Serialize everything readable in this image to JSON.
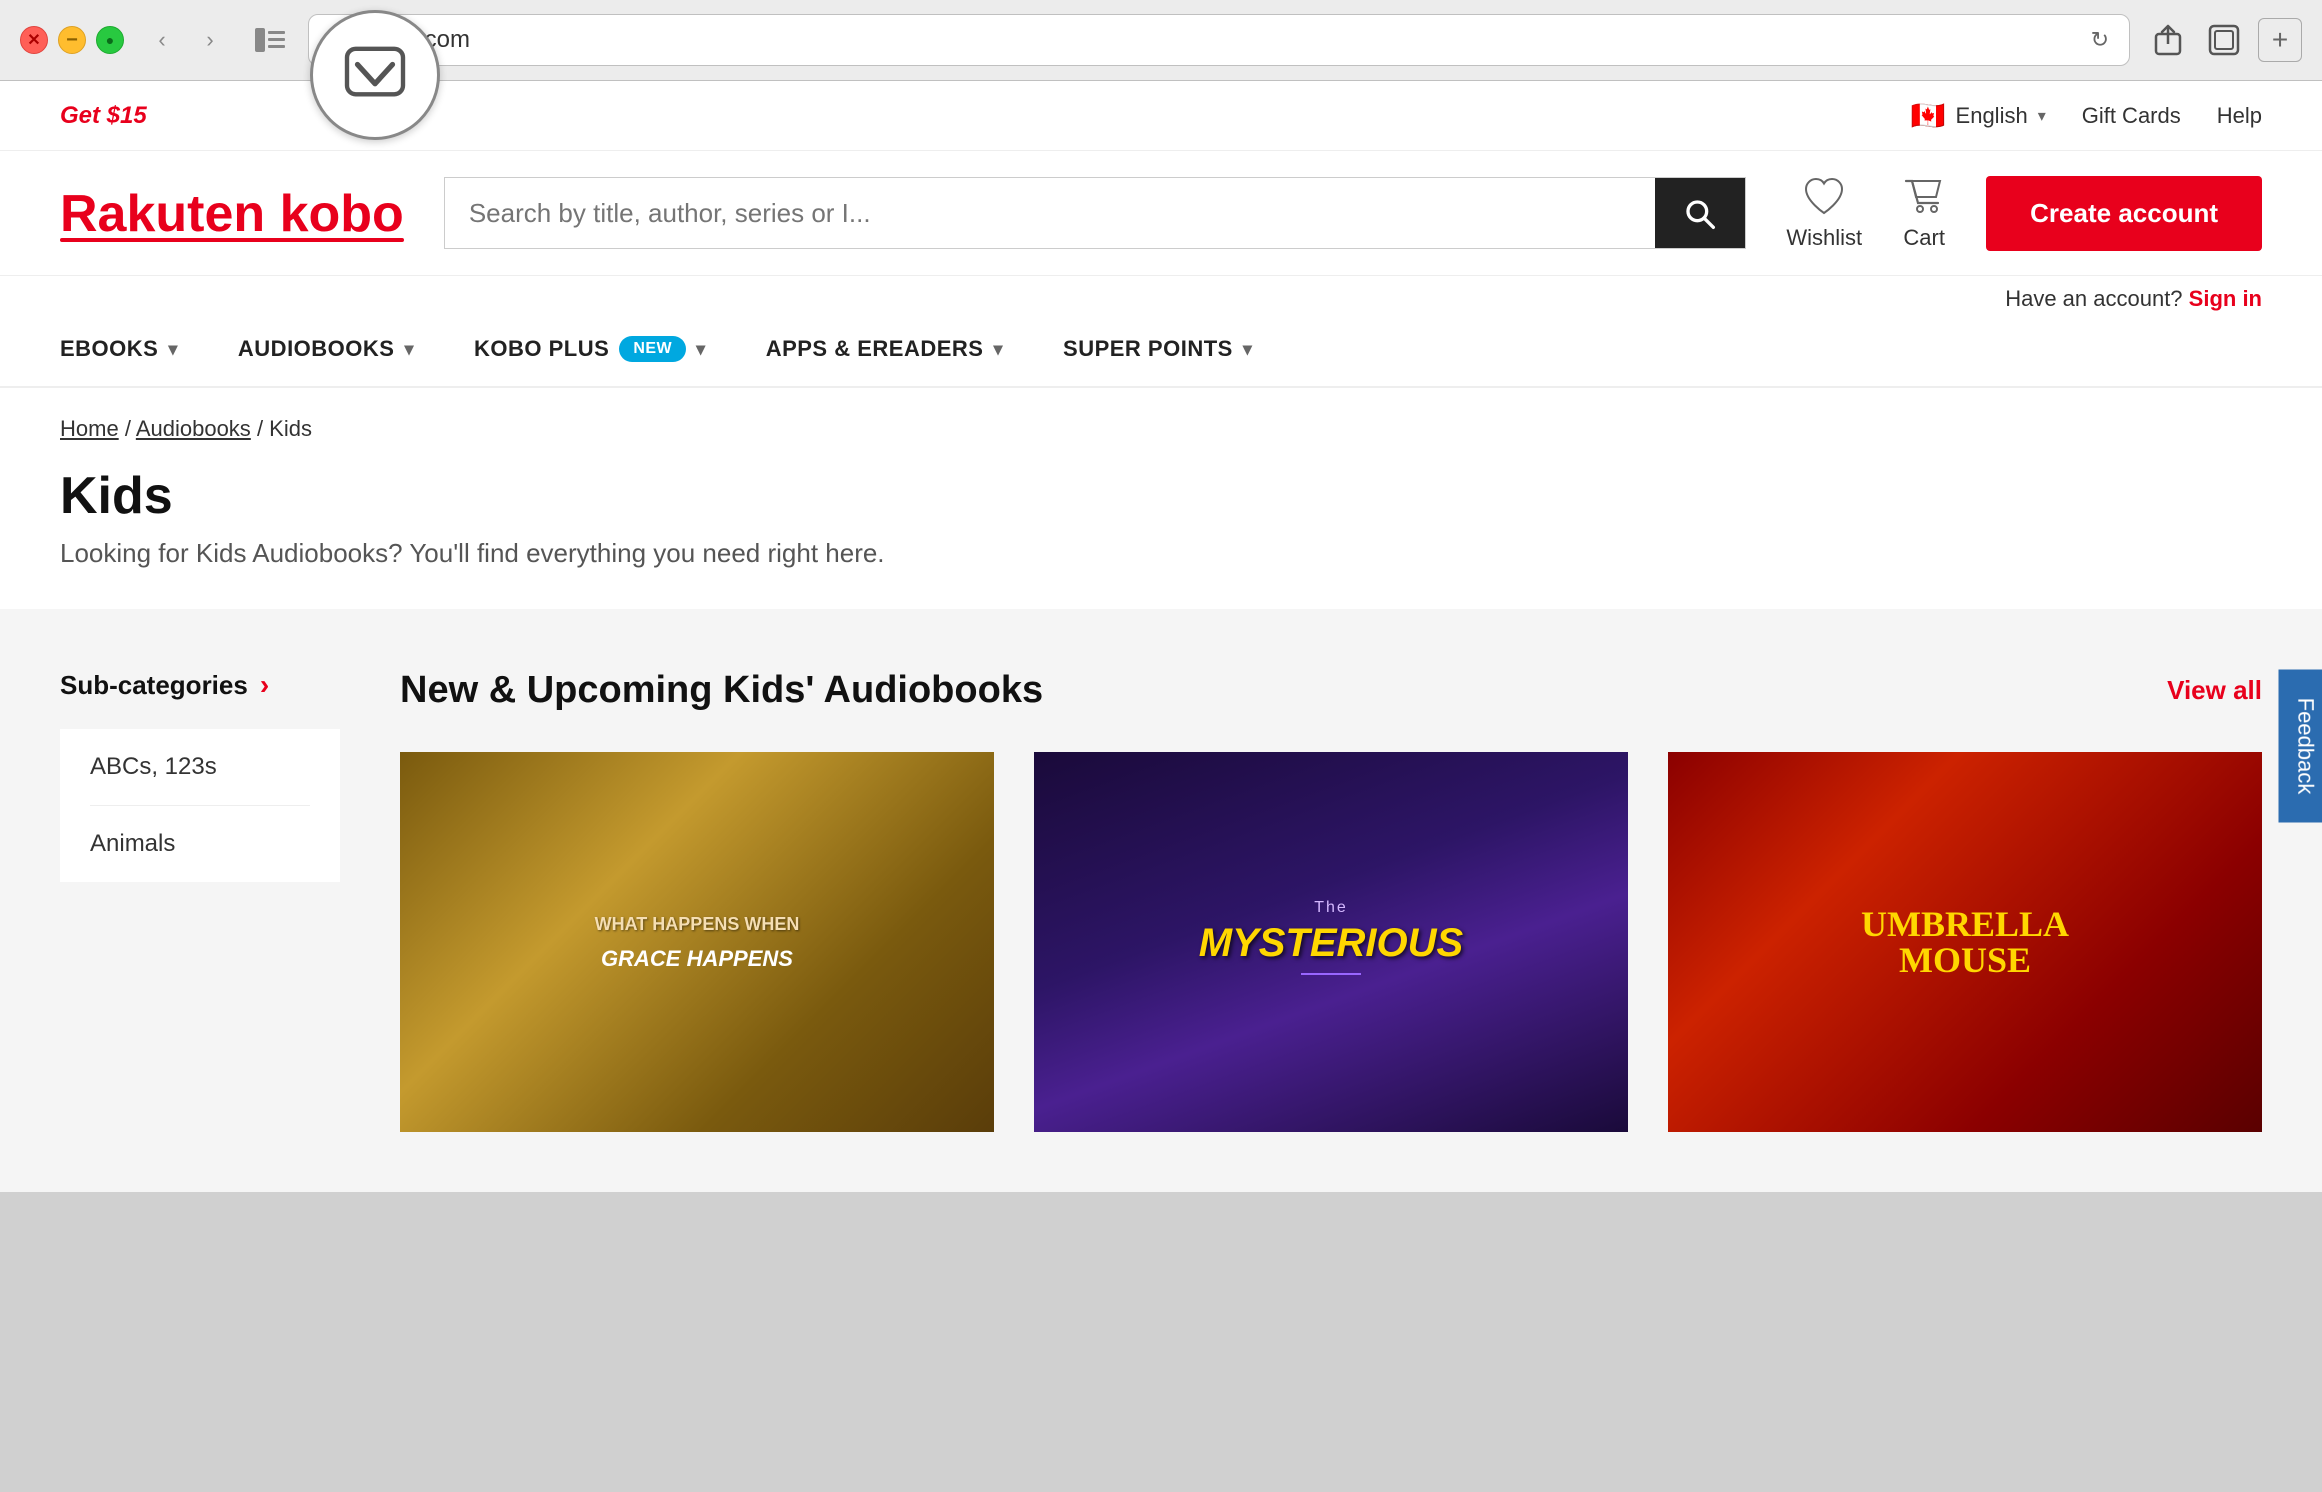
{
  "browser": {
    "url": "kobo.com",
    "back_label": "‹",
    "forward_label": "›"
  },
  "topbar": {
    "promo": "Get $15",
    "flag": "🇨🇦",
    "language": "English",
    "gift_cards": "Gift Cards",
    "help": "Help"
  },
  "header": {
    "logo_rakuten": "Rakuten",
    "logo_kobo": " kobo",
    "search_placeholder": "Search by title, author, series or I...",
    "wishlist_label": "Wishlist",
    "cart_label": "Cart",
    "create_account": "Create account",
    "have_account": "Have an account?",
    "sign_in": "Sign in"
  },
  "nav": {
    "items": [
      {
        "label": "eBOOKS",
        "has_dropdown": true
      },
      {
        "label": "AUDIOBOOKS",
        "has_dropdown": true
      },
      {
        "label": "KOBO PLUS",
        "has_dropdown": true,
        "badge": "NEW"
      },
      {
        "label": "APPS & eREADERS",
        "has_dropdown": true
      },
      {
        "label": "SUPER POINTS",
        "has_dropdown": true
      }
    ]
  },
  "breadcrumb": {
    "home": "Home",
    "audiobooks": "Audiobooks",
    "current": "Kids"
  },
  "page": {
    "title": "Kids",
    "subtitle": "Looking for Kids Audiobooks? You'll find everything you need right here."
  },
  "sidebar": {
    "header": "Sub-categories",
    "items": [
      {
        "label": "ABCs, 123s"
      },
      {
        "label": "Animals"
      }
    ]
  },
  "section": {
    "title": "New & Upcoming Kids' Audiobooks",
    "view_all": "View all"
  },
  "books": [
    {
      "id": 1,
      "type": "brown",
      "cover_text": "WHAT HAPPENS WHEN GRACE HAPPENS",
      "cover_author": ""
    },
    {
      "id": 2,
      "type": "purple",
      "cover_title": "The\nMYSTERIOUS",
      "cover_subtitle": ""
    },
    {
      "id": 3,
      "type": "red",
      "cover_title": "UMBRELLA\nMOUSE",
      "cover_subtitle": ""
    }
  ],
  "feedback": {
    "label": "Feedback"
  },
  "icons": {
    "search": "🔍",
    "heart": "♡",
    "cart": "🛒",
    "lock": "🔒",
    "pocket": "⬡"
  }
}
